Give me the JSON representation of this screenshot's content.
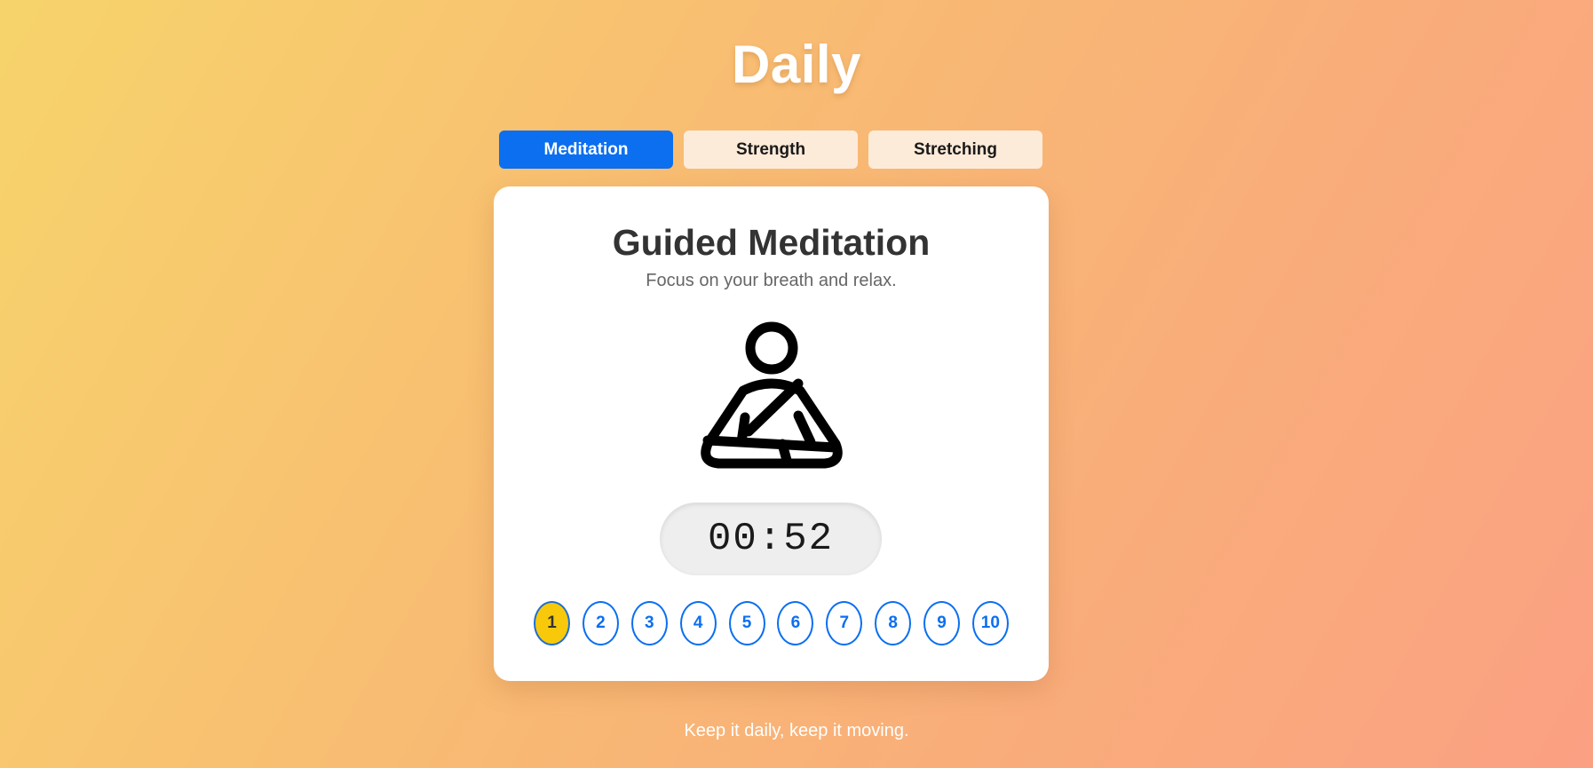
{
  "app": {
    "title": "Daily"
  },
  "tabs": [
    {
      "label": "Meditation",
      "active": true
    },
    {
      "label": "Strength",
      "active": false
    },
    {
      "label": "Stretching",
      "active": false
    }
  ],
  "card": {
    "title": "Guided Meditation",
    "subtitle": "Focus on your breath and relax.",
    "icon": "meditation-figure-icon",
    "timer": "00:52",
    "steps": [
      "1",
      "2",
      "3",
      "4",
      "5",
      "6",
      "7",
      "8",
      "9",
      "10"
    ],
    "current_step": "1"
  },
  "footer": {
    "text": "Keep it daily, keep it moving."
  },
  "colors": {
    "accent": "#0b6ff0",
    "highlight": "#f8c90a",
    "tab_inactive": "#fdebd9",
    "gradient_start": "#f7d46b",
    "gradient_end": "#fba083"
  }
}
